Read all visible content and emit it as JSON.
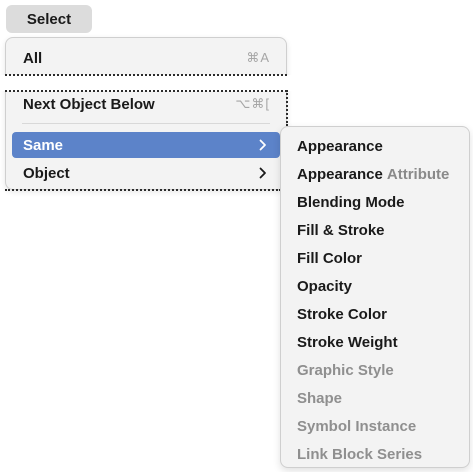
{
  "menubar": {
    "title": "Select"
  },
  "main_menu": {
    "items": [
      {
        "label": "All",
        "shortcut": "⌘A",
        "has_submenu": false,
        "highlighted": false
      },
      {
        "label": "Next Object Below",
        "shortcut": "⌥⌘[",
        "has_submenu": false,
        "highlighted": false
      },
      {
        "label": "Same",
        "shortcut": "",
        "has_submenu": true,
        "highlighted": true
      },
      {
        "label": "Object",
        "shortcut": "",
        "has_submenu": true,
        "highlighted": false
      }
    ]
  },
  "submenu": {
    "items": [
      {
        "label": "Appearance",
        "extra": "",
        "enabled": true
      },
      {
        "label": "Appearance",
        "extra": "Attribute",
        "enabled": true
      },
      {
        "label": "Blending Mode",
        "extra": "",
        "enabled": true
      },
      {
        "label": "Fill & Stroke",
        "extra": "",
        "enabled": true
      },
      {
        "label": "Fill Color",
        "extra": "",
        "enabled": true
      },
      {
        "label": "Opacity",
        "extra": "",
        "enabled": true
      },
      {
        "label": "Stroke Color",
        "extra": "",
        "enabled": true
      },
      {
        "label": "Stroke Weight",
        "extra": "",
        "enabled": true
      },
      {
        "label": "Graphic Style",
        "extra": "",
        "enabled": false
      },
      {
        "label": "Shape",
        "extra": "",
        "enabled": false
      },
      {
        "label": "Symbol Instance",
        "extra": "",
        "enabled": false
      },
      {
        "label": "Link Block Series",
        "extra": "",
        "enabled": false
      }
    ]
  },
  "colors": {
    "highlight": "#5c83c9",
    "menu_background": "#f3f3f3",
    "disabled_text": "#8f8f8f"
  }
}
